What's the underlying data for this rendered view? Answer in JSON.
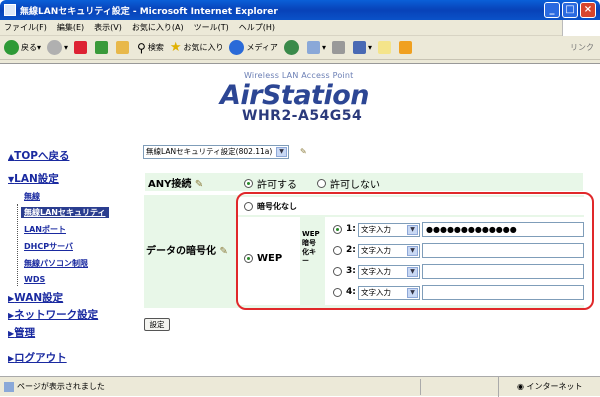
{
  "window": {
    "title": "無線LANセキュリティ設定 - Microsoft Internet Explorer"
  },
  "menu": [
    "ファイル(F)",
    "編集(E)",
    "表示(V)",
    "お気に入り(A)",
    "ツール(T)",
    "ヘルプ(H)"
  ],
  "toolbar": {
    "back": "戻る",
    "search": "検索",
    "favorites": "お気に入り",
    "media": "メディア",
    "links": "リンク"
  },
  "header": {
    "subtitle": "Wireless LAN Access Point",
    "logo": "AirStation",
    "model": "WHR2-A54G54"
  },
  "nav": {
    "top": "TOPへ戻る",
    "lan": "LAN設定",
    "lan_items": [
      "無線",
      "無線LANセキュリティ",
      "LANポート",
      "DHCPサーバ",
      "無線パソコン制限",
      "WDS"
    ],
    "wan": "WAN設定",
    "network": "ネットワーク設定",
    "admin": "管理",
    "logout": "ログアウト"
  },
  "form": {
    "mode_select": "無線LANセキュリティ設定(802.11a)",
    "any_label": "ANY接続",
    "any_allow": "許可する",
    "any_deny": "許可しない",
    "enc_label": "データの暗号化",
    "no_enc": "暗号化なし",
    "wep": "WEP",
    "wep_key_header": "WEP暗号化キー",
    "keys": [
      {
        "num": "1:",
        "type": "文字入力",
        "value": "●●●●●●●●●●●●●",
        "selected": true
      },
      {
        "num": "2:",
        "type": "文字入力",
        "value": "",
        "selected": false
      },
      {
        "num": "3:",
        "type": "文字入力",
        "value": "",
        "selected": false
      },
      {
        "num": "4:",
        "type": "文字入力",
        "value": "",
        "selected": false
      }
    ],
    "submit": "設定"
  },
  "status": {
    "text": "ページが表示されました",
    "zone": "インターネット"
  }
}
